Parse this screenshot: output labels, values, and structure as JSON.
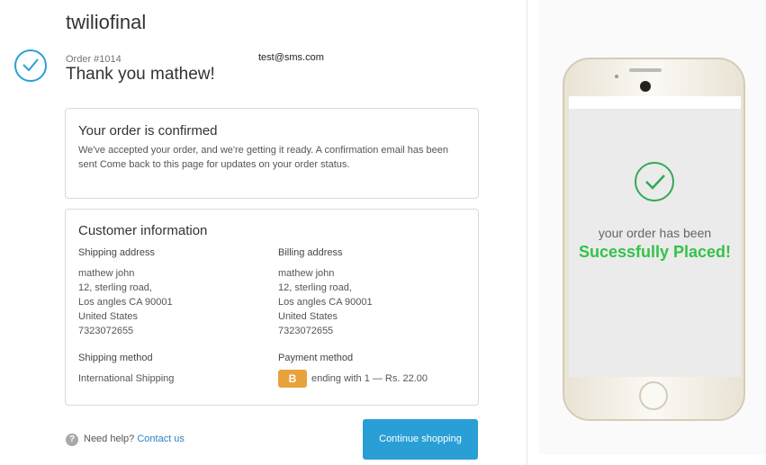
{
  "shop": {
    "title": "twiliofinal"
  },
  "order": {
    "number": "Order #1014",
    "email": "test@sms.com",
    "thanks": "Thank you mathew!"
  },
  "confirmation": {
    "heading": "Your order is confirmed",
    "line1": "We've accepted your order, and we're getting it ready. A confirmation email has been",
    "line2": "sent   Come back to this page for updates on your order  status."
  },
  "customer": {
    "heading": "Customer information",
    "shipping_address_label": "Shipping address",
    "billing_address_label": "Billing address",
    "shipping_address": [
      "mathew john",
      "12, sterling road,",
      "Los angles CA 90001",
      "United States",
      "7323072655"
    ],
    "billing_address": [
      "mathew john",
      "12, sterling road,",
      "Los angles CA 90001",
      "United States",
      "7323072655"
    ],
    "shipping_method_label": "Shipping method",
    "shipping_method": "International Shipping",
    "payment_method_label": "Payment method",
    "payment_badge": "B",
    "payment_text": "ending with 1 — Rs. 22.00"
  },
  "footer": {
    "help_icon": "?",
    "help_text": "Need help?",
    "help_link": "Contact us",
    "continue_button": "Continue shopping"
  },
  "phone": {
    "message": "your order has been",
    "success": "Sucessfully Placed!"
  },
  "colors": {
    "accent": "#2a9fd6",
    "success": "#34c24a",
    "payment_badge": "#e8a23b"
  }
}
